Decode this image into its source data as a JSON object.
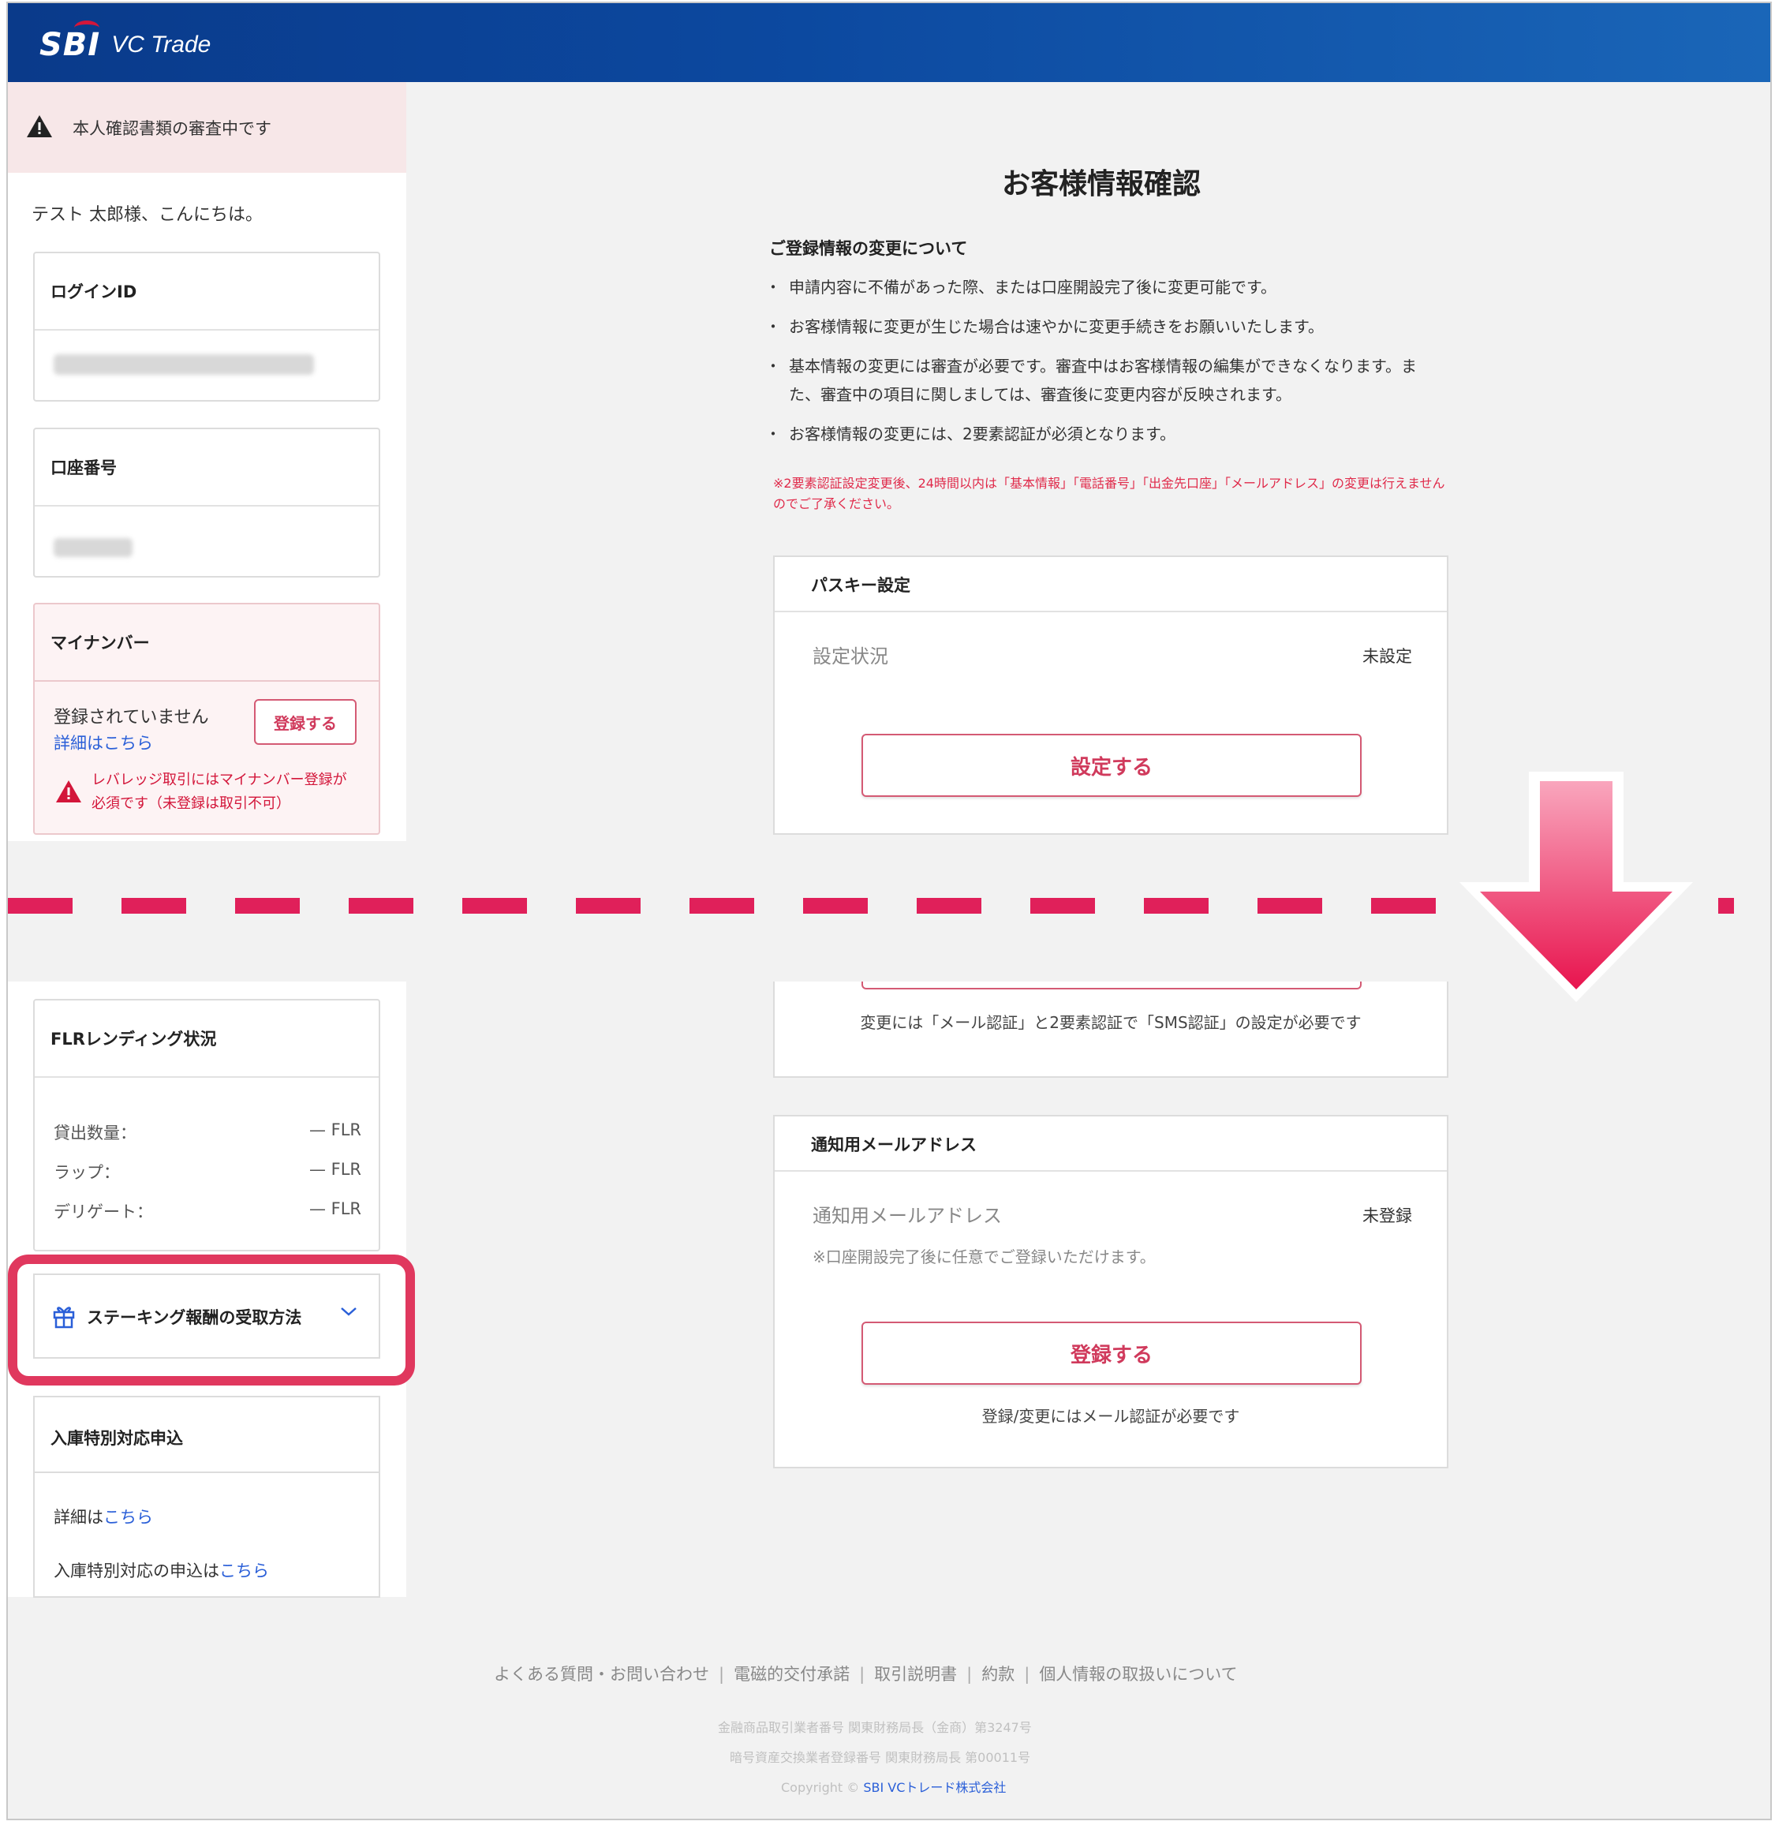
{
  "header": {
    "logo_sbi": "SBI",
    "logo_vc": "VC Trade"
  },
  "sidebar": {
    "alert": "本人確認書類の審査中です",
    "greeting": "テスト 太郎様、こんにちは。",
    "login_id_label": "ログインID",
    "account_label": "口座番号",
    "mynumber_label": "マイナンバー",
    "mynumber_status": "登録されていません",
    "mynumber_detail_link": "詳細はこちら",
    "mynumber_register_button": "登録する",
    "mynumber_warning": "レバレッジ取引にはマイナンバー登録が必須です（未登録は取引不可）",
    "flr_label": "FLRレンディング状況",
    "flr_rows": [
      {
        "label": "貸出数量：",
        "value": "— FLR"
      },
      {
        "label": "ラップ：",
        "value": "— FLR"
      },
      {
        "label": "デリゲート：",
        "value": "— FLR"
      }
    ],
    "staking_label": "ステーキング報酬の受取方法",
    "nyuko_label": "入庫特別対応申込",
    "nyuko_detail_prefix": "詳細は",
    "nyuko_detail_link": "こちら",
    "nyuko_apply_prefix": "入庫特別対応の申込は",
    "nyuko_apply_link": "こちら"
  },
  "main": {
    "title": "お客様情報確認",
    "section_title": "ご登録情報の変更について",
    "bullets": [
      "申請内容に不備があった際、または口座開設完了後に変更可能です。",
      "お客様情報に変更が生じた場合は速やかに変更手続きをお願いいたします。",
      "基本情報の変更には審査が必要です。審査中はお客様情報の編集ができなくなります。また、審査中の項目に関しましては、審査後に変更内容が反映されます。",
      "お客様情報の変更には、2要素認証が必須となります。"
    ],
    "red_note": "※2要素認証設定変更後、24時間以内は「基本情報」「電話番号」「出金先口座」「メールアドレス」の変更は行えませんのでご了承ください。",
    "passkey": {
      "header": "パスキー設定",
      "label": "設定状況",
      "status": "未設定",
      "button": "設定する"
    },
    "partial_note": "変更には「メール認証」と2要素認証で「SMS認証」の設定が必要です",
    "notify": {
      "header": "通知用メールアドレス",
      "label": "通知用メールアドレス",
      "status": "未登録",
      "sub": "※口座開設完了後に任意でご登録いただけます。",
      "button": "登録する",
      "note": "登録/変更にはメール認証が必要です"
    }
  },
  "footer": {
    "links": [
      "よくある質問・お問い合わせ",
      "電磁的交付承諾",
      "取引説明書",
      "約款",
      "個人情報の取扱いについて"
    ],
    "separator": "|",
    "fine1": "金融商品取引業者番号 関東財務局長（金商）第3247号",
    "fine2": "暗号資産交換業者登録番号 関東財務局長 第00011号",
    "copyright": "Copyright ©",
    "company": "SBI VCトレード株式会社"
  },
  "colors": {
    "header_blue": "#0c49a0",
    "accent_red": "#e0205a",
    "button_border": "#d45a74",
    "link_blue": "#2a5fd8"
  },
  "icons": [
    "warning-triangle-icon",
    "gift-icon",
    "chevron-down-icon",
    "down-arrow-icon"
  ]
}
